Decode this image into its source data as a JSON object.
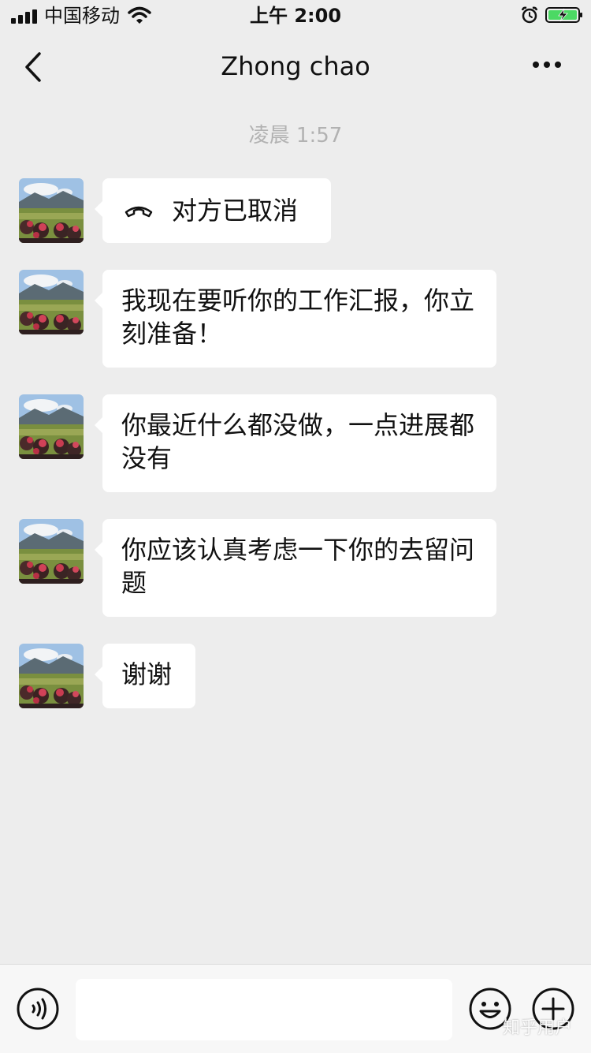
{
  "status_bar": {
    "carrier": "中国移动",
    "time": "上午 2:00"
  },
  "nav": {
    "title": "Zhong chao"
  },
  "chat": {
    "timestamp": "凌晨 1:57",
    "messages": [
      {
        "type": "call",
        "text": "对方已取消"
      },
      {
        "type": "text",
        "text": "我现在要听你的工作汇报，你立刻准备！"
      },
      {
        "type": "text",
        "text": "你最近什么都没做，一点进展都没有"
      },
      {
        "type": "text",
        "text": "你应该认真考虑一下你的去留问题"
      },
      {
        "type": "text",
        "text": "谢谢"
      }
    ]
  },
  "input": {
    "value": ""
  },
  "watermark": "知乎用户",
  "colors": {
    "background": "#ededed",
    "bubble": "#ffffff",
    "battery_green": "#4cd964",
    "timestamp_gray": "#b2b2b2"
  },
  "icons": {
    "back": "chevron-left-icon",
    "more": "ellipsis-icon",
    "call": "hangup-phone-icon",
    "voice": "voice-icon",
    "emoji": "emoji-icon",
    "plus": "plus-circle-icon"
  }
}
